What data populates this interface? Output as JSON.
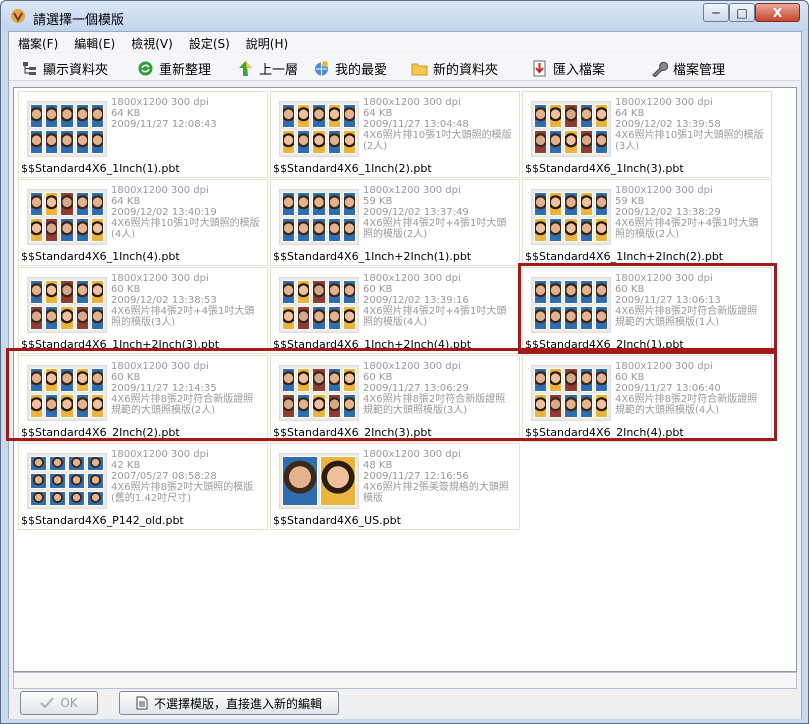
{
  "window": {
    "title": "請選擇一個模版",
    "min_label": "─",
    "max_label": "□",
    "close_label": "X"
  },
  "menu": [
    {
      "label": "檔案(F)"
    },
    {
      "label": "編輯(E)"
    },
    {
      "label": "檢視(V)"
    },
    {
      "label": "設定(S)"
    },
    {
      "label": "說明(H)"
    }
  ],
  "toolbar": {
    "show_folder": "顯示資料夾",
    "reorganize": "重新整理",
    "up": "上一層",
    "favorites": "我的最愛",
    "new_folder": "新的資料夾",
    "import": "匯入檔案",
    "manage": "檔案管理"
  },
  "templates": [
    {
      "name": "$$Standard4X6_1Inch(1).pbt",
      "res": "1800x1200 300 dpi",
      "size": "64 KB",
      "date": "2009/11/27 12:08:43",
      "desc": ""
    },
    {
      "name": "$$Standard4X6_1Inch(2).pbt",
      "res": "1800x1200 300 dpi",
      "size": "64 KB",
      "date": "2009/11/27 13:04:48",
      "desc": "4X6照片排10張1吋大頭照的模版(2人)"
    },
    {
      "name": "$$Standard4X6_1Inch(3).pbt",
      "res": "1800x1200 300 dpi",
      "size": "64 KB",
      "date": "2009/12/02 13:39:58",
      "desc": "4X6照片排10張1吋大頭照的模版(3人)"
    },
    {
      "name": "$$Standard4X6_1Inch(4).pbt",
      "res": "1800x1200 300 dpi",
      "size": "64 KB",
      "date": "2009/12/02 13:40:19",
      "desc": "4X6照片排10張1吋大頭照的模版(4人)"
    },
    {
      "name": "$$Standard4X6_1Inch+2Inch(1).pbt",
      "res": "1800x1200 300 dpi",
      "size": "59 KB",
      "date": "2009/12/02 13:37:49",
      "desc": "4X6照片排4張2吋+4張1吋大頭照的模版(2人)"
    },
    {
      "name": "$$Standard4X6_1Inch+2Inch(2).pbt",
      "res": "1800x1200 300 dpi",
      "size": "59 KB",
      "date": "2009/12/02 13:38:29",
      "desc": "4X6照片排4張2吋+4張1吋大頭照的模版(2人)"
    },
    {
      "name": "$$Standard4X6_1Inch+2Inch(3).pbt",
      "res": "1800x1200 300 dpi",
      "size": "60 KB",
      "date": "2009/12/02 13:38:53",
      "desc": "4X6照片排4張2吋+4張1吋大頭照的模版(3人)"
    },
    {
      "name": "$$Standard4X6_1Inch+2Inch(4).pbt",
      "res": "1800x1200 300 dpi",
      "size": "60 KB",
      "date": "2009/12/02 13:39:16",
      "desc": "4X6照片排4張2吋+4張1吋大頭照的模版(4人)"
    },
    {
      "name": "$$Standard4X6_2Inch(1).pbt",
      "res": "1800x1200 300 dpi",
      "size": "60 KB",
      "date": "2009/11/27 13:06:13",
      "desc": "4X6照片排8張2吋符合新版證照規範的大頭照模版(1人)"
    },
    {
      "name": "$$Standard4X6_2Inch(2).pbt",
      "res": "1800x1200 300 dpi",
      "size": "60 KB",
      "date": "2009/11/27 12:14:35",
      "desc": "4X6照片排8張2吋符合新版證照規範的大頭照模版(2人)"
    },
    {
      "name": "$$Standard4X6_2Inch(3).pbt",
      "res": "1800x1200 300 dpi",
      "size": "60 KB",
      "date": "2009/11/27 13:06:29",
      "desc": "4X6照片排8張2吋符合新版證照規範的大頭照模版(3人)"
    },
    {
      "name": "$$Standard4X6_2Inch(4).pbt",
      "res": "1800x1200 300 dpi",
      "size": "60 KB",
      "date": "2009/11/27 13:06:40",
      "desc": "4X6照片排8張2吋符合新版證照規範的大頭照模版(4人)"
    },
    {
      "name": "$$Standard4X6_P142_old.pbt",
      "res": "1800x1200 300 dpi",
      "size": "42 KB",
      "date": "2007/05/27 08:58:28",
      "desc": "4X6照片排8張2吋大頭照的模版(舊的1.42吋尺寸)"
    },
    {
      "name": "$$Standard4X6_US.pbt",
      "res": "1800x1200 300 dpi",
      "size": "48 KB",
      "date": "2009/11/27 12:16:56",
      "desc": "4X6照片排2張美簽規格的大頭照模版"
    }
  ],
  "buttons": {
    "ok": "OK",
    "no_select": "不選擇模版，直接進入新的編輯"
  },
  "colors": {
    "highlight": "#a31a1a"
  }
}
